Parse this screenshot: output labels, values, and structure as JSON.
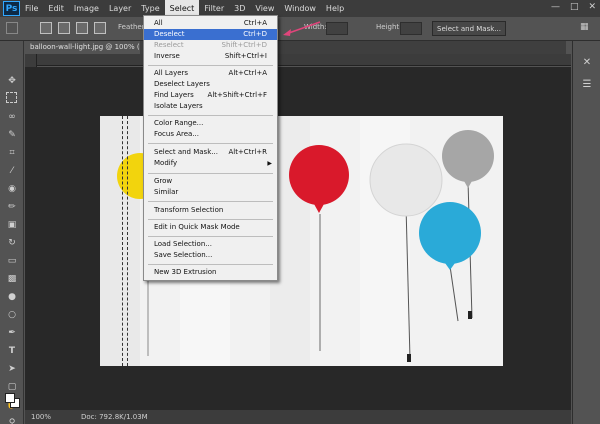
{
  "menubar": {
    "logo": "Ps",
    "items": [
      "File",
      "Edit",
      "Image",
      "Layer",
      "Type",
      "Select",
      "Filter",
      "3D",
      "View",
      "Window",
      "Help"
    ],
    "active_index": 5
  },
  "options": {
    "feather_label": "Feathers:",
    "width_label": "Width:",
    "height_label": "Height:",
    "select_mask_button": "Select and Mask..."
  },
  "document": {
    "tab_title": "balloon-wall-light.jpg @ 100% (Lay"
  },
  "status": {
    "zoom": "100%",
    "doc": "Doc: 792.8K/1.03M"
  },
  "select_menu": {
    "items": [
      {
        "label": "All",
        "shortcut": "Ctrl+A",
        "state": "normal"
      },
      {
        "label": "Deselect",
        "shortcut": "Ctrl+D",
        "state": "highlighted"
      },
      {
        "label": "Reselect",
        "shortcut": "Shift+Ctrl+D",
        "state": "disabled"
      },
      {
        "label": "Inverse",
        "shortcut": "Shift+Ctrl+I",
        "state": "normal"
      },
      {
        "label": "All Layers",
        "shortcut": "Alt+Ctrl+A",
        "state": "normal"
      },
      {
        "label": "Deselect Layers",
        "shortcut": "",
        "state": "normal"
      },
      {
        "label": "Find Layers",
        "shortcut": "Alt+Shift+Ctrl+F",
        "state": "normal"
      },
      {
        "label": "Isolate Layers",
        "shortcut": "",
        "state": "normal"
      },
      {
        "label": "Color Range...",
        "shortcut": "",
        "state": "normal"
      },
      {
        "label": "Focus Area...",
        "shortcut": "",
        "state": "normal"
      },
      {
        "label": "Select and Mask...",
        "shortcut": "Alt+Ctrl+R",
        "state": "normal"
      },
      {
        "label": "Modify",
        "shortcut": "",
        "state": "submenu"
      },
      {
        "label": "Grow",
        "shortcut": "",
        "state": "normal"
      },
      {
        "label": "Similar",
        "shortcut": "",
        "state": "normal"
      },
      {
        "label": "Transform Selection",
        "shortcut": "",
        "state": "normal"
      },
      {
        "label": "Edit in Quick Mask Mode",
        "shortcut": "",
        "state": "normal"
      },
      {
        "label": "Load Selection...",
        "shortcut": "",
        "state": "normal"
      },
      {
        "label": "Save Selection...",
        "shortcut": "",
        "state": "normal"
      },
      {
        "label": "New 3D Extrusion",
        "shortcut": "",
        "state": "normal"
      }
    ]
  },
  "colors": {
    "highlight": "#3a6fd0",
    "annotation_arrow": "#e0457b",
    "balloon_yellow": "#f2d40d",
    "balloon_red": "#d9192b",
    "balloon_white": "#e8e8e8",
    "balloon_blue": "#2aaad8",
    "balloon_gray": "#a6a6a6"
  }
}
